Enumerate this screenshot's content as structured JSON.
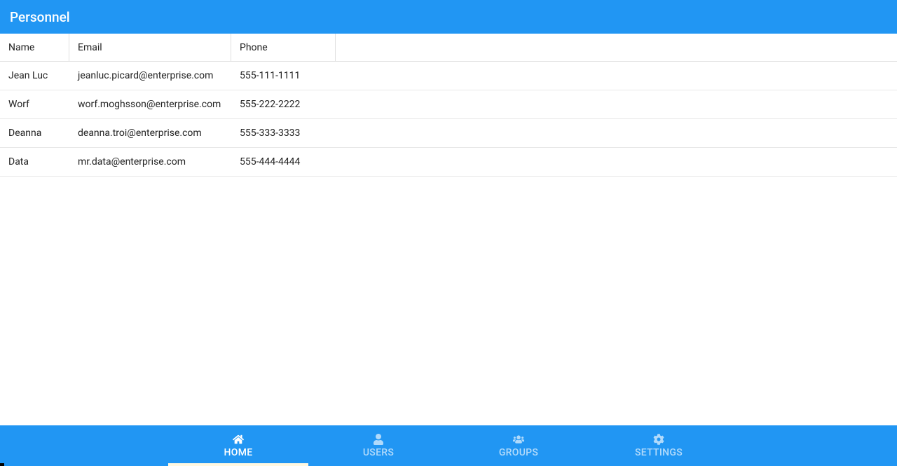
{
  "header": {
    "title": "Personnel"
  },
  "table": {
    "columns": [
      "Name",
      "Email",
      "Phone"
    ],
    "rows": [
      {
        "name": "Jean Luc",
        "email": "jeanluc.picard@enterprise.com",
        "phone": "555-111-1111"
      },
      {
        "name": "Worf",
        "email": "worf.moghsson@enterprise.com",
        "phone": "555-222-2222"
      },
      {
        "name": "Deanna",
        "email": "deanna.troi@enterprise.com",
        "phone": "555-333-3333"
      },
      {
        "name": "Data",
        "email": "mr.data@enterprise.com",
        "phone": "555-444-4444"
      }
    ]
  },
  "nav": {
    "items": [
      {
        "label": "HOME",
        "icon": "house-icon",
        "active": true
      },
      {
        "label": "USERS",
        "icon": "user-icon",
        "active": false
      },
      {
        "label": "GROUPS",
        "icon": "users-icon",
        "active": false
      },
      {
        "label": "SETTINGS",
        "icon": "gear-icon",
        "active": false
      }
    ]
  }
}
